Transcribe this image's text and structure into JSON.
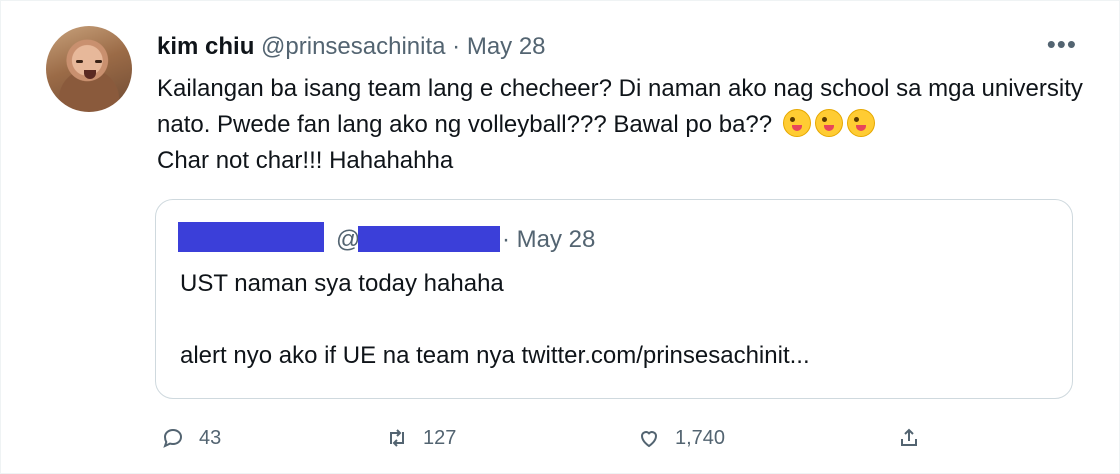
{
  "tweet": {
    "author_name": "kim chiu",
    "handle": "@prinsesachinita",
    "separator": "·",
    "date": "May 28",
    "more_label": "•••",
    "text": "Kailangan ba isang team lang e checheer? Di naman ako nag school sa mga university nato. Pwede fan lang ako ng volleyball??? Bawal po ba??",
    "text_tail": "Char not char!!! Hahahahha",
    "emoji": "zany-face-emoji"
  },
  "quoted": {
    "handle_prefix": "@",
    "date": "· May 28",
    "line1": "UST naman sya today hahaha",
    "line2": "alert nyo ako if UE na team nya twitter.com/prinsesachinit...",
    "redaction_color": "#3b3fd9"
  },
  "actions": {
    "replies": "43",
    "retweets": "127",
    "likes": "1,740"
  },
  "colors": {
    "text": "#0f1419",
    "secondary": "#536471",
    "border": "#cfd9de"
  }
}
